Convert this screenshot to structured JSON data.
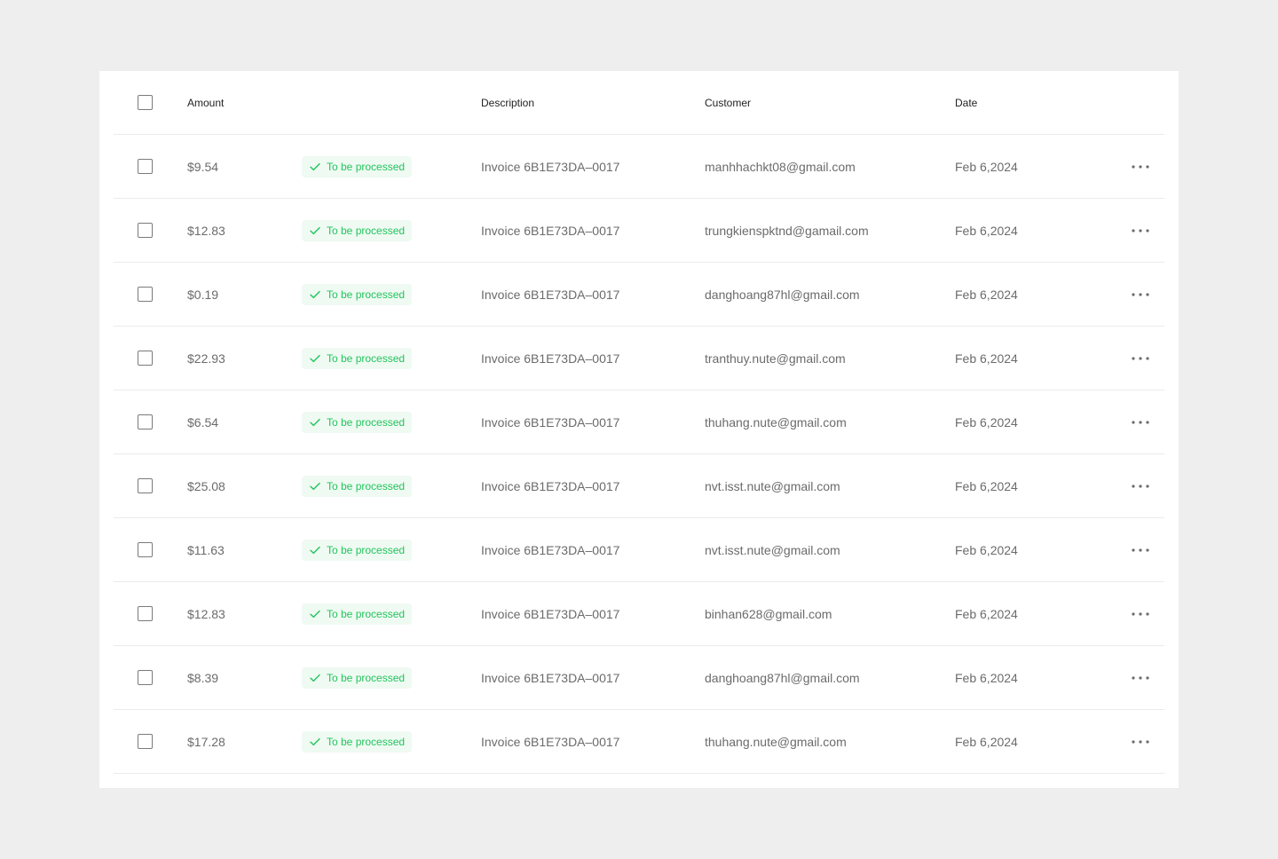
{
  "table": {
    "columns": {
      "amount": "Amount",
      "description": "Description",
      "customer": "Customer",
      "date": "Date"
    },
    "status_color": "#22C55E",
    "rows": [
      {
        "amount": "$9.54",
        "status": "To be processed",
        "description": "Invoice 6B1E73DA–0017",
        "customer": "manhhachkt08@gmail.com",
        "date": "Feb 6,2024"
      },
      {
        "amount": "$12.83",
        "status": "To be processed",
        "description": "Invoice 6B1E73DA–0017",
        "customer": "trungkienspktnd@gamail.com",
        "date": "Feb 6,2024"
      },
      {
        "amount": "$0.19",
        "status": "To be processed",
        "description": "Invoice 6B1E73DA–0017",
        "customer": "danghoang87hl@gmail.com",
        "date": "Feb 6,2024"
      },
      {
        "amount": "$22.93",
        "status": "To be processed",
        "description": "Invoice 6B1E73DA–0017",
        "customer": "tranthuy.nute@gmail.com",
        "date": "Feb 6,2024"
      },
      {
        "amount": "$6.54",
        "status": "To be processed",
        "description": "Invoice 6B1E73DA–0017",
        "customer": "thuhang.nute@gmail.com",
        "date": "Feb 6,2024"
      },
      {
        "amount": "$25.08",
        "status": "To be processed",
        "description": "Invoice 6B1E73DA–0017",
        "customer": "nvt.isst.nute@gmail.com",
        "date": "Feb 6,2024"
      },
      {
        "amount": "$11.63",
        "status": "To be processed",
        "description": "Invoice 6B1E73DA–0017",
        "customer": "nvt.isst.nute@gmail.com",
        "date": "Feb 6,2024"
      },
      {
        "amount": "$12.83",
        "status": "To be processed",
        "description": "Invoice 6B1E73DA–0017",
        "customer": "binhan628@gmail.com",
        "date": "Feb 6,2024"
      },
      {
        "amount": "$8.39",
        "status": "To be processed",
        "description": "Invoice 6B1E73DA–0017",
        "customer": "danghoang87hl@gmail.com",
        "date": "Feb 6,2024"
      },
      {
        "amount": "$17.28",
        "status": "To be processed",
        "description": "Invoice 6B1E73DA–0017",
        "customer": "thuhang.nute@gmail.com",
        "date": "Feb 6,2024"
      }
    ]
  }
}
